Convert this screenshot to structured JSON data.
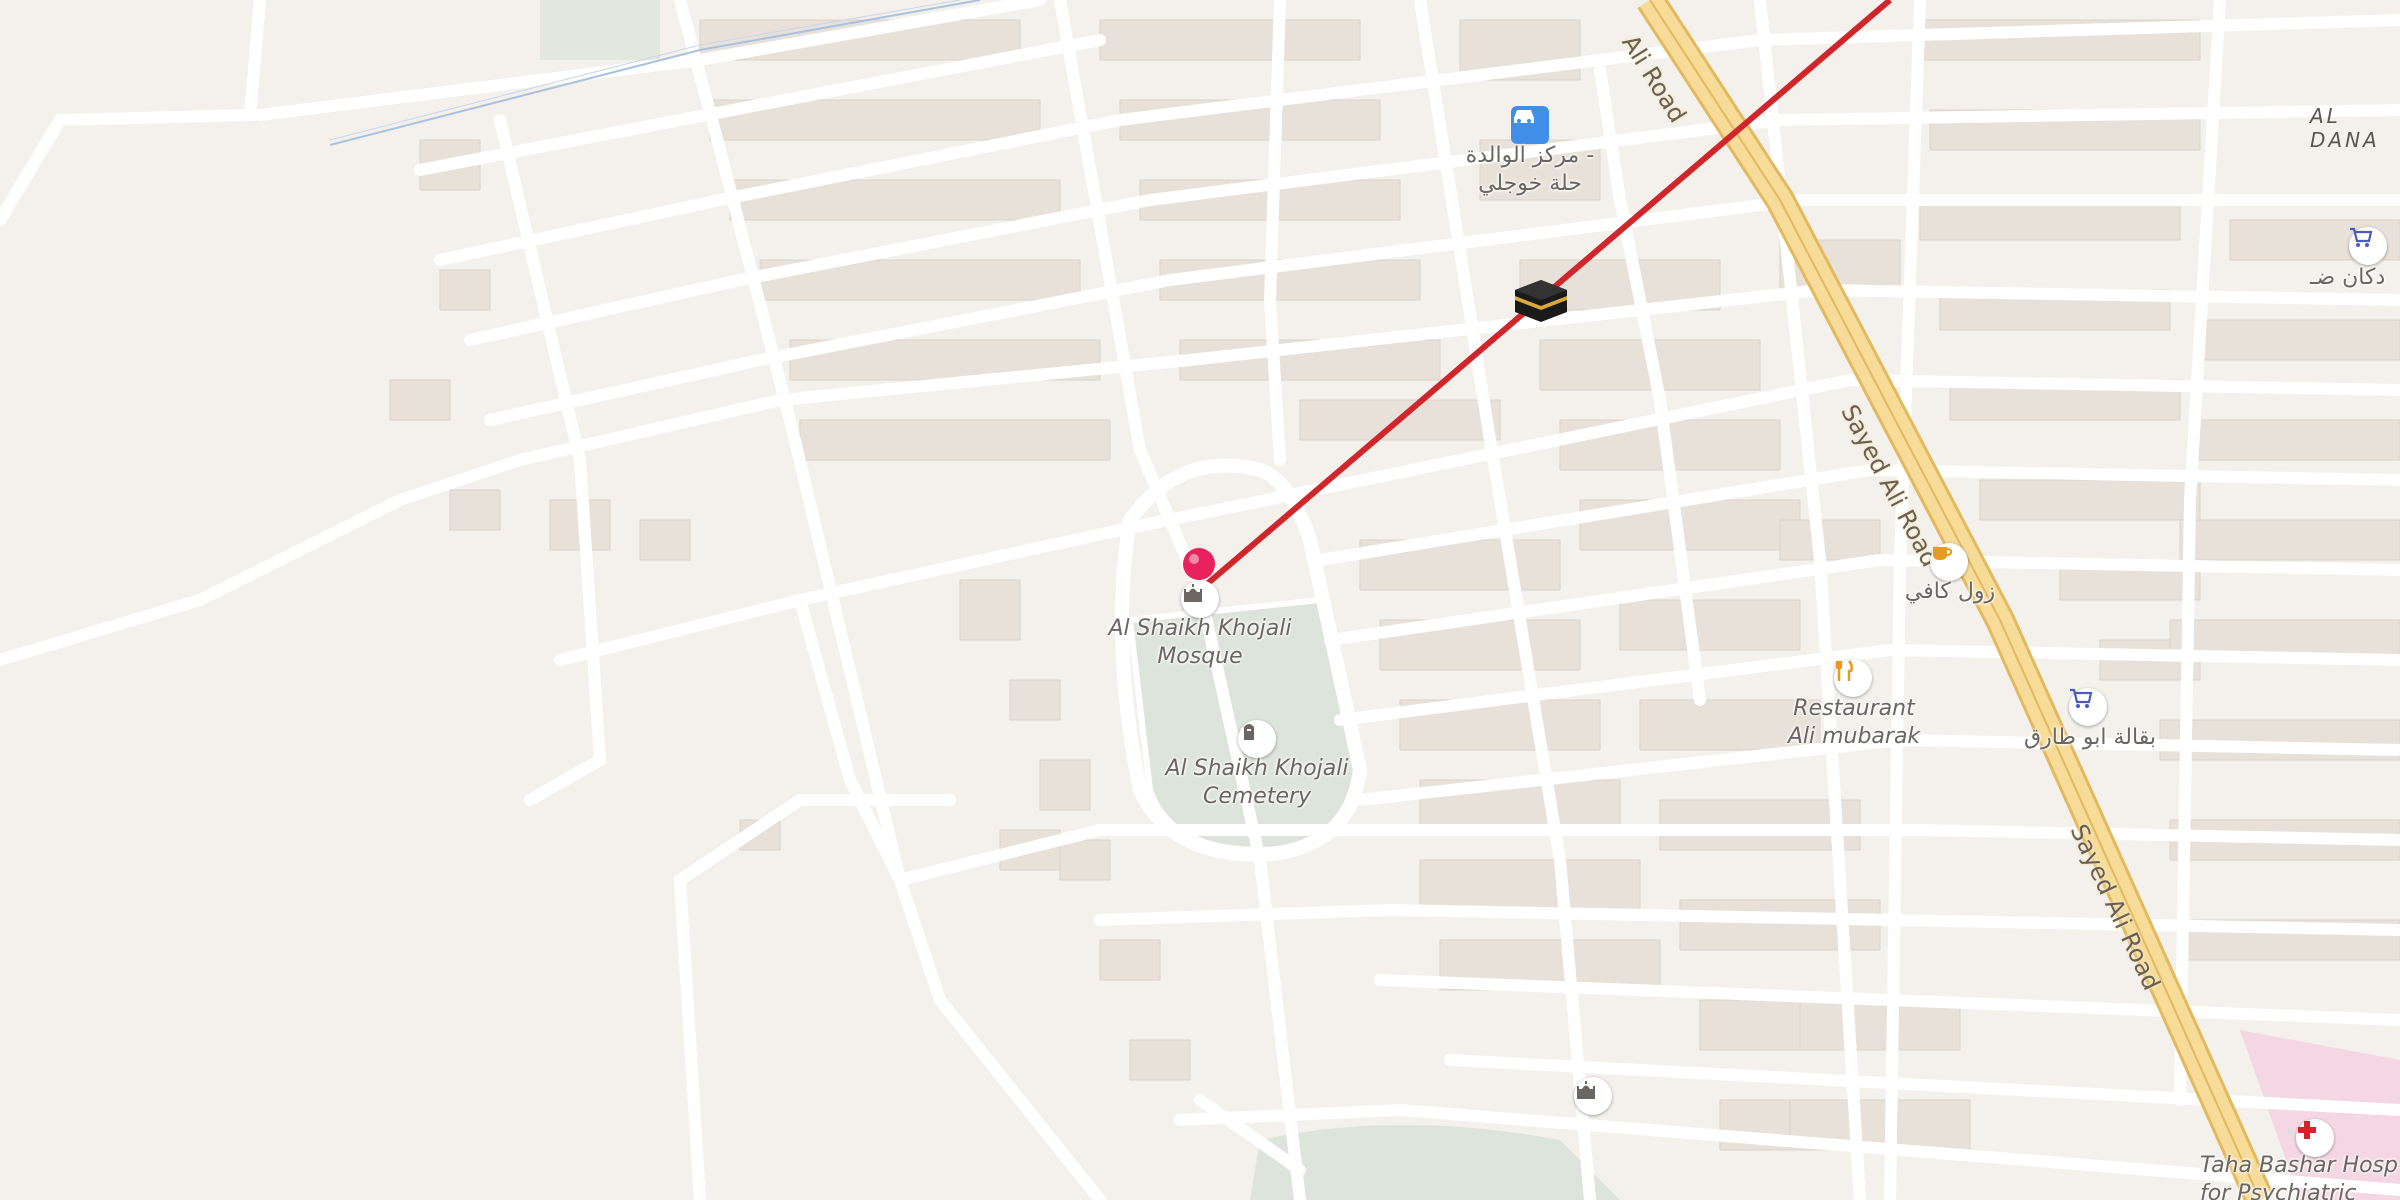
{
  "map": {
    "area_label": "AL DANA",
    "roads": [
      {
        "id": "sayed-ali-road",
        "name": "Sayed Ali Road"
      },
      {
        "id": "ali-road-top",
        "name": "Ali Road"
      }
    ],
    "pois": [
      {
        "id": "mosque",
        "name": "Al Shaikh Khojali Mosque",
        "line1": "Al Shaikh Khojali",
        "line2": "Mosque",
        "icon": "mosque-icon"
      },
      {
        "id": "cemetery",
        "name": "Al Shaikh Khojali Cemetery",
        "line1": "Al Shaikh Khojali",
        "line2": "Cemetery",
        "icon": "cemetery-icon"
      },
      {
        "id": "restaurant",
        "line1": "Restaurant",
        "line2": "Ali mubarak",
        "icon": "fork-knife-icon"
      },
      {
        "id": "cafe",
        "line1": "زول كافي",
        "icon": "coffee-icon"
      },
      {
        "id": "grocery-tariq",
        "line1": "بقالة ابو طارق",
        "icon": "cart-icon"
      },
      {
        "id": "grocery-right",
        "line1": "دكان ضـ",
        "icon": "cart-icon"
      },
      {
        "id": "car-center",
        "line1": "مركز الوالدة -",
        "line2": "حلة خوجلي",
        "icon": "car-icon"
      },
      {
        "id": "hospital",
        "line1": "Taha Bashar Hosp",
        "line2": "for Psychiatric",
        "icon": "hospital-cross-icon"
      },
      {
        "id": "mosque-2",
        "icon": "mosque-icon"
      }
    ],
    "qibla": {
      "icon": "kaaba-icon",
      "line_color": "#d0262b"
    },
    "pin": {
      "icon": "location-pin-icon",
      "color": "#e8225c"
    },
    "colors": {
      "background": "#f4f1ed",
      "road": "#ffffff",
      "road_outline": "#dcd6ce",
      "major_road": "#f6dc98",
      "major_road_outline": "#e3b95d",
      "building": "#e7e0d8",
      "green": "#dde6dc"
    }
  }
}
